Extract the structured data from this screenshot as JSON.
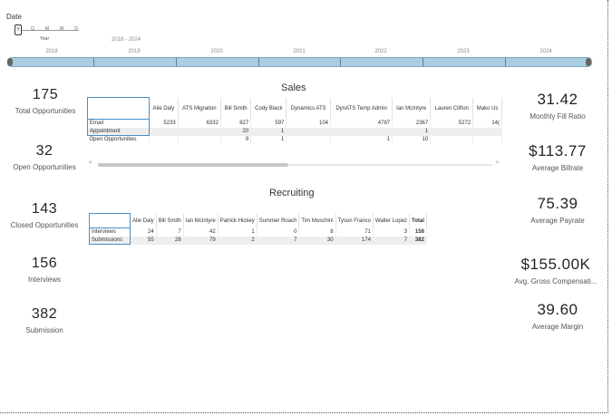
{
  "slicer": {
    "title": "Date",
    "granularity_options": [
      "Y",
      "Q",
      "M",
      "W",
      "D"
    ],
    "granularity_label": "Year",
    "range_label": "2018 - 2024",
    "years": [
      "2018",
      "2019",
      "2020",
      "2021",
      "2022",
      "2023",
      "2024"
    ]
  },
  "kpis_left": [
    {
      "value": "175",
      "label": "Total Opportunities"
    },
    {
      "value": "32",
      "label": "Open Opportunities"
    },
    {
      "value": "143",
      "label": "Closed Opportunities"
    },
    {
      "value": "156",
      "label": "Interviews"
    },
    {
      "value": "382",
      "label": "Submission"
    }
  ],
  "kpis_right": [
    {
      "value": "31.42",
      "label": "Monthly Fill Ratio"
    },
    {
      "value": "$113.77",
      "label": "Average Billrate"
    },
    {
      "value": "75.39",
      "label": "Average Payrate"
    },
    {
      "value": "$155.00K",
      "label": "Avg. Gross Compensati..."
    },
    {
      "value": "39.60",
      "label": "Average Margin"
    }
  ],
  "sales": {
    "title": "Sales",
    "columns": [
      "Alie Daly",
      "ATS Migration",
      "Bill Smith",
      "Cody Black",
      "Dynamics ATS",
      "DynATS Temp Admin",
      "Ian McIntyre",
      "Lauren Clifton",
      "Mako Us"
    ],
    "rows": [
      {
        "label": "Email",
        "cells": [
          "5233",
          "6332",
          "827",
          "597",
          "104",
          "4787",
          "2367",
          "5272",
          "14("
        ]
      },
      {
        "label": "Appointment",
        "cells": [
          "",
          "",
          "20",
          "1",
          "",
          "",
          "1",
          "",
          ""
        ]
      },
      {
        "label": "Open Opportunities",
        "cells": [
          "",
          "",
          "9",
          "1",
          "",
          "1",
          "10",
          "",
          ""
        ]
      }
    ],
    "scroll_left": "<",
    "scroll_right": ">"
  },
  "recruiting": {
    "title": "Recruiting",
    "columns": [
      "Alie Daly",
      "Bill Smith",
      "Ian McIntyre",
      "Patrick Hickey",
      "Summer Roach",
      "Tim Moschini",
      "Tyson Franco",
      "Walter Lopez",
      "Total"
    ],
    "rows": [
      {
        "label": "Interviews",
        "cells": [
          "24",
          "7",
          "42",
          "1",
          "0",
          "8",
          "71",
          "3",
          "156"
        ]
      },
      {
        "label": "Submissions",
        "cells": [
          "55",
          "28",
          "79",
          "2",
          "7",
          "30",
          "174",
          "7",
          "382"
        ]
      }
    ]
  },
  "colors": {
    "timeline_fill": "#a9cfe0",
    "timeline_border": "#7aa5bb",
    "header_accent": "#4a8fc7"
  }
}
